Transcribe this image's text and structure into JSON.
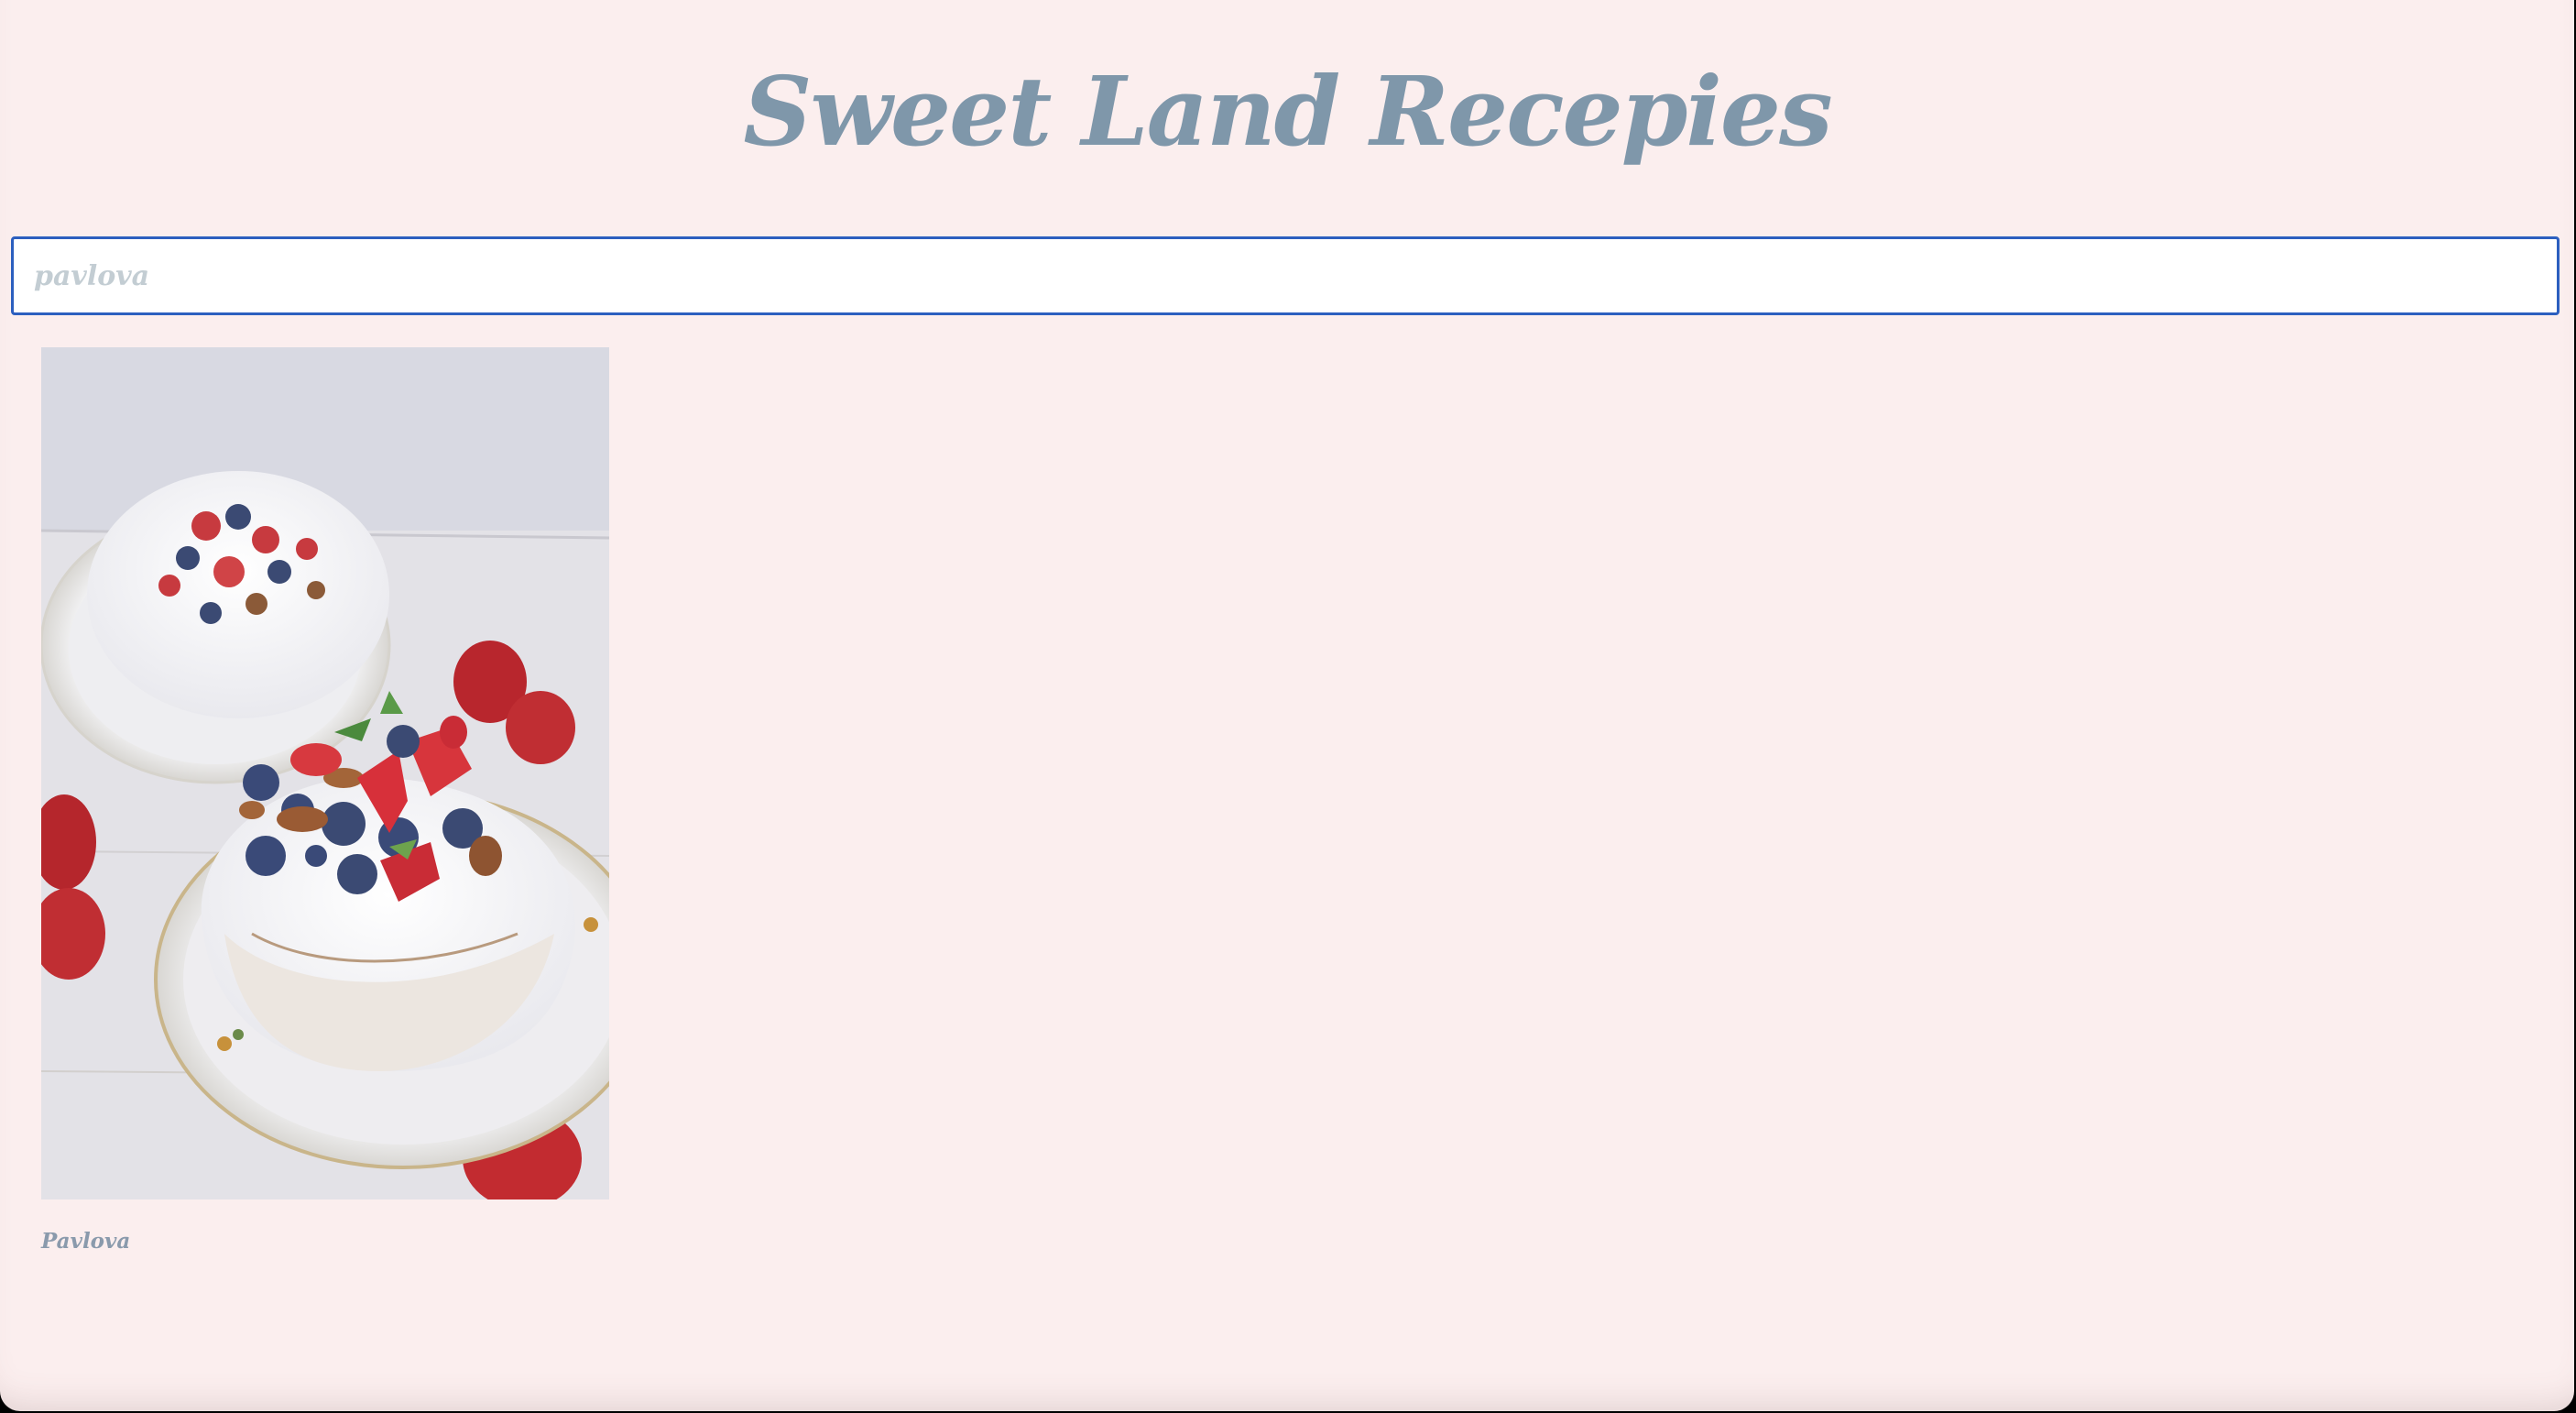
{
  "header": {
    "title": "Sweet Land Recepies"
  },
  "search": {
    "placeholder": "pavlova",
    "value": ""
  },
  "results": [
    {
      "name": "Pavlova",
      "image_description": "pavlova-photo"
    }
  ],
  "colors": {
    "background": "#fbeeee",
    "title": "#7f97aa",
    "search_border": "#2c5fbf",
    "placeholder": "#c3cdd3",
    "card_label": "#8a9aac"
  }
}
